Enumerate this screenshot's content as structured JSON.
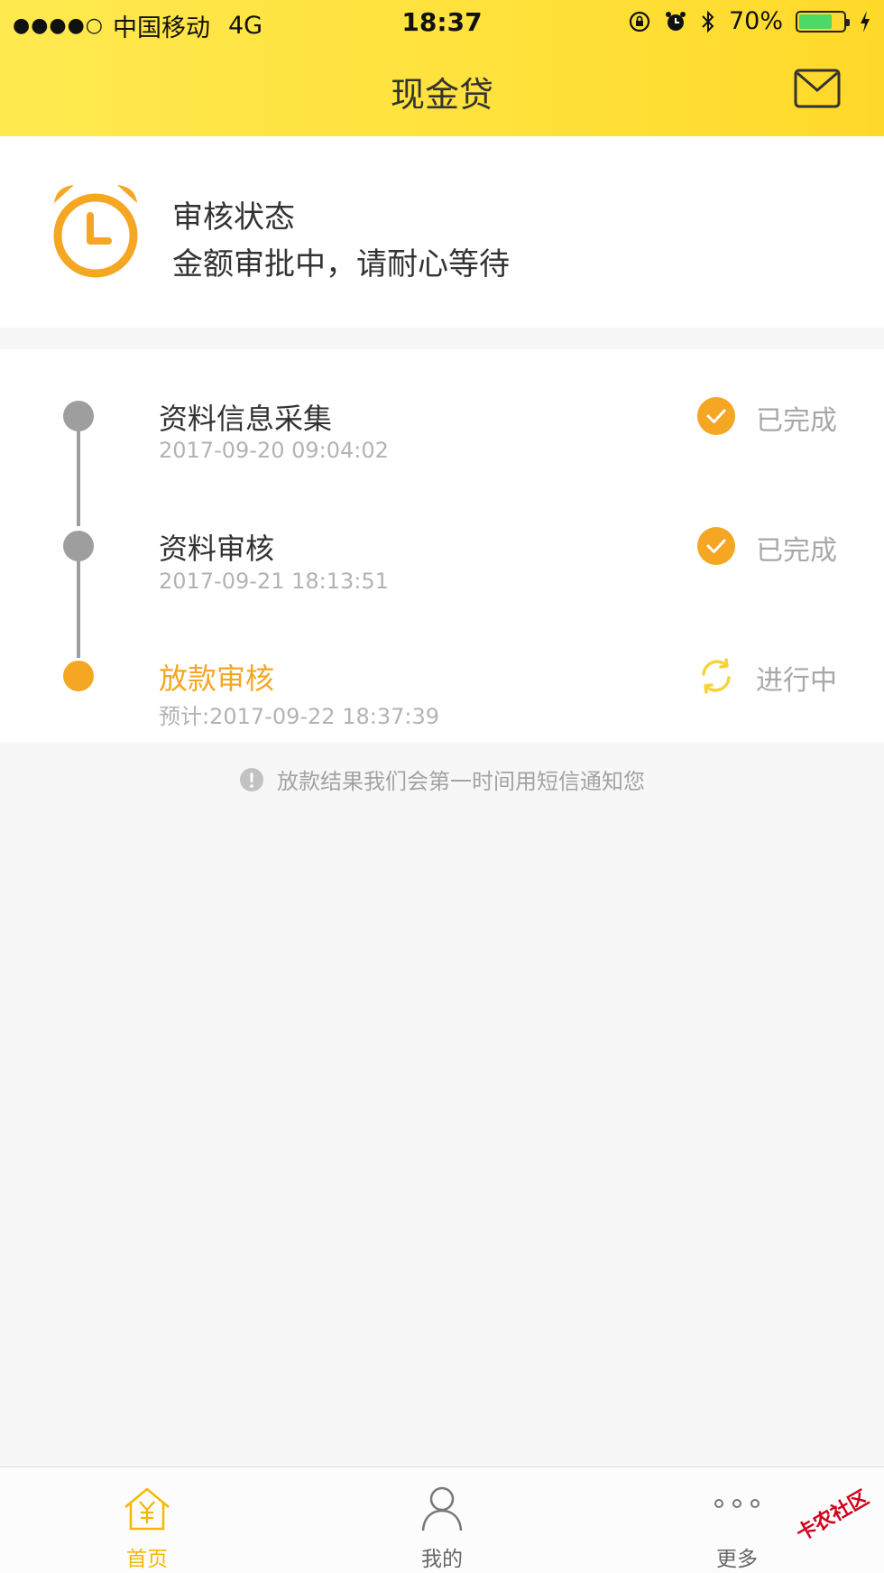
{
  "status_bar": {
    "carrier": "中国移动",
    "network": "4G",
    "time": "18:37",
    "battery_percent": "70%",
    "battery_level": 0.7
  },
  "nav": {
    "title": "现金贷",
    "mail_icon": "mail-icon"
  },
  "review": {
    "icon": "alarm-clock-icon",
    "title": "审核状态",
    "description": "金额审批中，请耐心等待"
  },
  "steps": [
    {
      "title": "资料信息采集",
      "time": "2017-09-20 09:04:02",
      "status": "已完成",
      "state": "done"
    },
    {
      "title": "资料审核",
      "time": "2017-09-21 18:13:51",
      "status": "已完成",
      "state": "done"
    },
    {
      "title": "放款审核",
      "time": "预计:2017-09-22 18:37:39",
      "status": "进行中",
      "state": "in-progress"
    }
  ],
  "notice": "放款结果我们会第一时间用短信通知您",
  "tabs": [
    {
      "label": "首页",
      "icon": "home-icon",
      "active": true
    },
    {
      "label": "我的",
      "icon": "user-icon",
      "active": false
    },
    {
      "label": "更多",
      "icon": "more-icon",
      "active": false
    }
  ],
  "watermark": "卡农社区",
  "colors": {
    "accent": "#f5a623",
    "header_yellow": "#ffe13a",
    "tab_active": "#f5b800",
    "inactive_gray": "#9e9e9e"
  }
}
